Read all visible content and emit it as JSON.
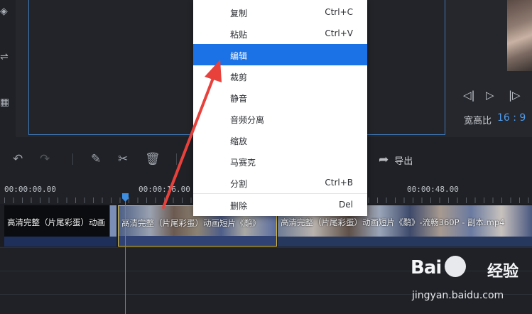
{
  "context_menu": {
    "items": [
      {
        "label": "复制",
        "shortcut": "Ctrl+C"
      },
      {
        "label": "粘贴",
        "shortcut": "Ctrl+V"
      },
      {
        "label": "编辑",
        "shortcut": ""
      },
      {
        "label": "裁剪",
        "shortcut": ""
      },
      {
        "label": "静音",
        "shortcut": ""
      },
      {
        "label": "音频分离",
        "shortcut": ""
      },
      {
        "label": "缩放",
        "shortcut": ""
      },
      {
        "label": "马赛克",
        "shortcut": ""
      },
      {
        "label": "分割",
        "shortcut": "Ctrl+B"
      },
      {
        "label": "删除",
        "shortcut": "Del"
      }
    ],
    "highlight_color": "#1a72e6"
  },
  "right_panel": {
    "aspect_ratio_label": "宽高比",
    "aspect_ratio_value": "16 : 9",
    "icons": [
      "step-back-icon",
      "play-icon",
      "step-forward-icon"
    ]
  },
  "toolbar": {
    "icons": [
      "undo-icon",
      "redo-icon",
      "pencil-icon",
      "scissors-icon",
      "trash-icon",
      "export-icon"
    ],
    "export_label": "导出"
  },
  "ruler": {
    "labels": [
      "00:00:00.00",
      "00:00:16.00",
      "00:00:48.00"
    ]
  },
  "timeline": {
    "clips": [
      {
        "caption": "高清完整（片尾彩蛋）动画"
      },
      {
        "caption": "高清完整（片尾彩蛋）动画短片《鹬》"
      },
      {
        "caption": "高清完整（片尾彩蛋）动画短片《鹬》-流畅360P - 副本.mp4"
      }
    ],
    "playhead_color": "#3d8de0",
    "selected_clip_border": "#d8b93e"
  },
  "watermark": {
    "brand": "Bai",
    "brand_suffix": "经验",
    "url": "jingyan.baidu.com"
  },
  "annotation": {
    "arrow_color": "#e8413c"
  }
}
